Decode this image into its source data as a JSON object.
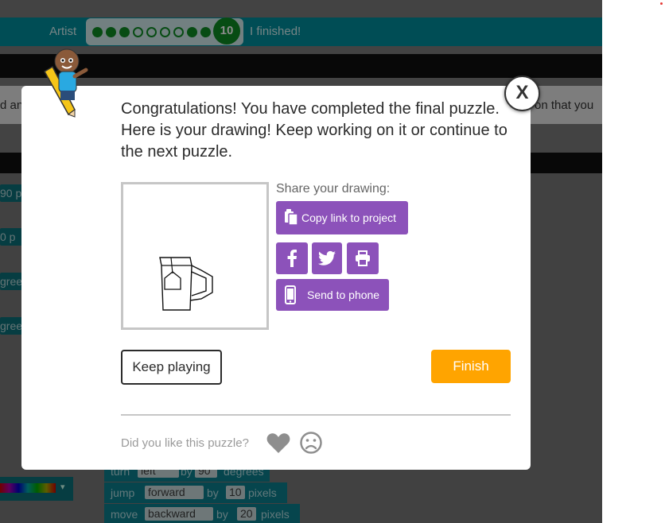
{
  "app": {
    "level_label": "Artist",
    "progress": {
      "dots": [
        "full",
        "full",
        "full",
        "empty",
        "empty",
        "empty",
        "empty",
        "full",
        "full"
      ],
      "current": "10"
    },
    "finished_label": "I finished!",
    "instruction_left": "d an",
    "instruction_right": "on that you"
  },
  "workspace": {
    "side_blocks": [
      "90 p",
      "0 p",
      "gree",
      "grees"
    ],
    "code": [
      {
        "kw1": "turn",
        "field1": "left",
        "kw2": "by",
        "field2": "90",
        "kw3": "degrees"
      },
      {
        "kw1": "jump",
        "field1": "forward",
        "kw2": "by",
        "field2": "10",
        "kw3": "pixels"
      },
      {
        "kw1": "move",
        "field1": "backward",
        "kw2": "by",
        "field2": "20",
        "kw3": "pixels"
      }
    ]
  },
  "dialog": {
    "close_label": "X",
    "message": "Congratulations! You have completed the final puzzle. Here is your drawing! Keep working on it or continue to the next puzzle.",
    "share_label": "Share your drawing:",
    "copy_link_label": "Copy link to project",
    "send_to_phone_label": "Send to phone",
    "keep_playing_label": "Keep playing",
    "finish_label": "Finish",
    "feedback_question": "Did you like this puzzle?"
  },
  "icons": [
    "pencil-mascot-icon",
    "clipboard-icon",
    "facebook-icon",
    "twitter-icon",
    "printer-icon",
    "phone-icon",
    "heart-icon",
    "sad-face-icon"
  ],
  "colors": {
    "teal": "#008d9c",
    "purple": "#8c52ba",
    "orange": "#ffa400",
    "green": "#0e8a24"
  }
}
